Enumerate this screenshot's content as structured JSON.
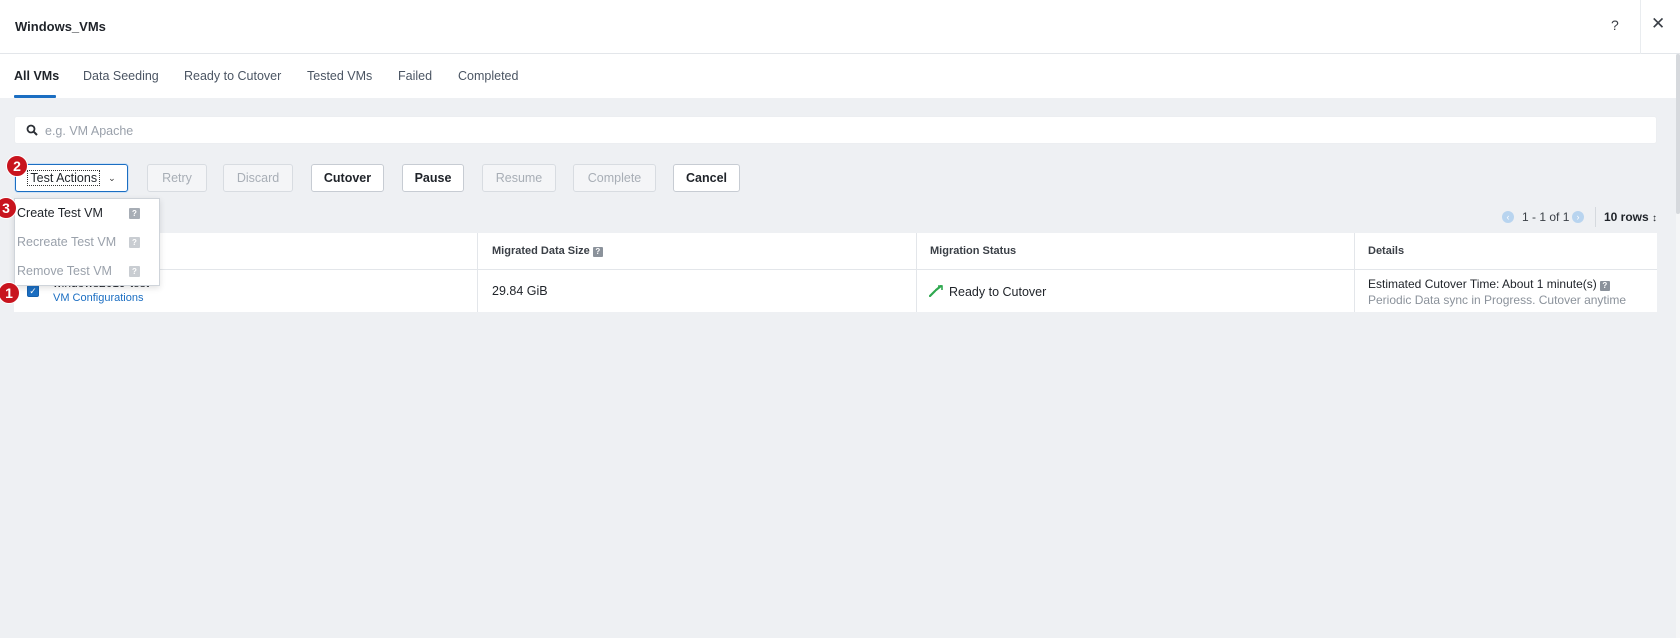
{
  "window": {
    "title": "Windows_VMs",
    "help_label": "?",
    "close_label": "✕"
  },
  "tabs": [
    {
      "label": "All VMs",
      "active": true
    },
    {
      "label": "Data Seeding"
    },
    {
      "label": "Ready to Cutover"
    },
    {
      "label": "Tested VMs"
    },
    {
      "label": "Failed"
    },
    {
      "label": "Completed"
    }
  ],
  "search": {
    "placeholder": "e.g. VM Apache",
    "value": ""
  },
  "actions": {
    "test_actions": "Test Actions",
    "retry": "Retry",
    "discard": "Discard",
    "cutover": "Cutover",
    "pause": "Pause",
    "resume": "Resume",
    "complete": "Complete",
    "cancel": "Cancel"
  },
  "test_menu": [
    {
      "label": "Create Test VM",
      "enabled": true
    },
    {
      "label": "Recreate Test VM",
      "enabled": false
    },
    {
      "label": "Remove Test VM",
      "enabled": false
    }
  ],
  "pagination": {
    "range": "1 - 1 of 1",
    "rows": "10 rows"
  },
  "table": {
    "headers": {
      "size": "Migrated Data Size",
      "status": "Migration Status",
      "details": "Details"
    },
    "rows": [
      {
        "vm_name": "windows2019-test",
        "vm_link": "VM Configurations",
        "size": "29.84 GiB",
        "status": "Ready to Cutover",
        "detail_line1": "Estimated Cutover Time: About 1 minute(s)",
        "detail_line2": "Periodic Data sync in Progress. Cutover anytime",
        "checked": true
      }
    ]
  },
  "markers": [
    "1",
    "2",
    "3"
  ],
  "colors": {
    "accent": "#1b6ec2",
    "marker": "#c8141e",
    "status_green": "#2fa84f"
  }
}
